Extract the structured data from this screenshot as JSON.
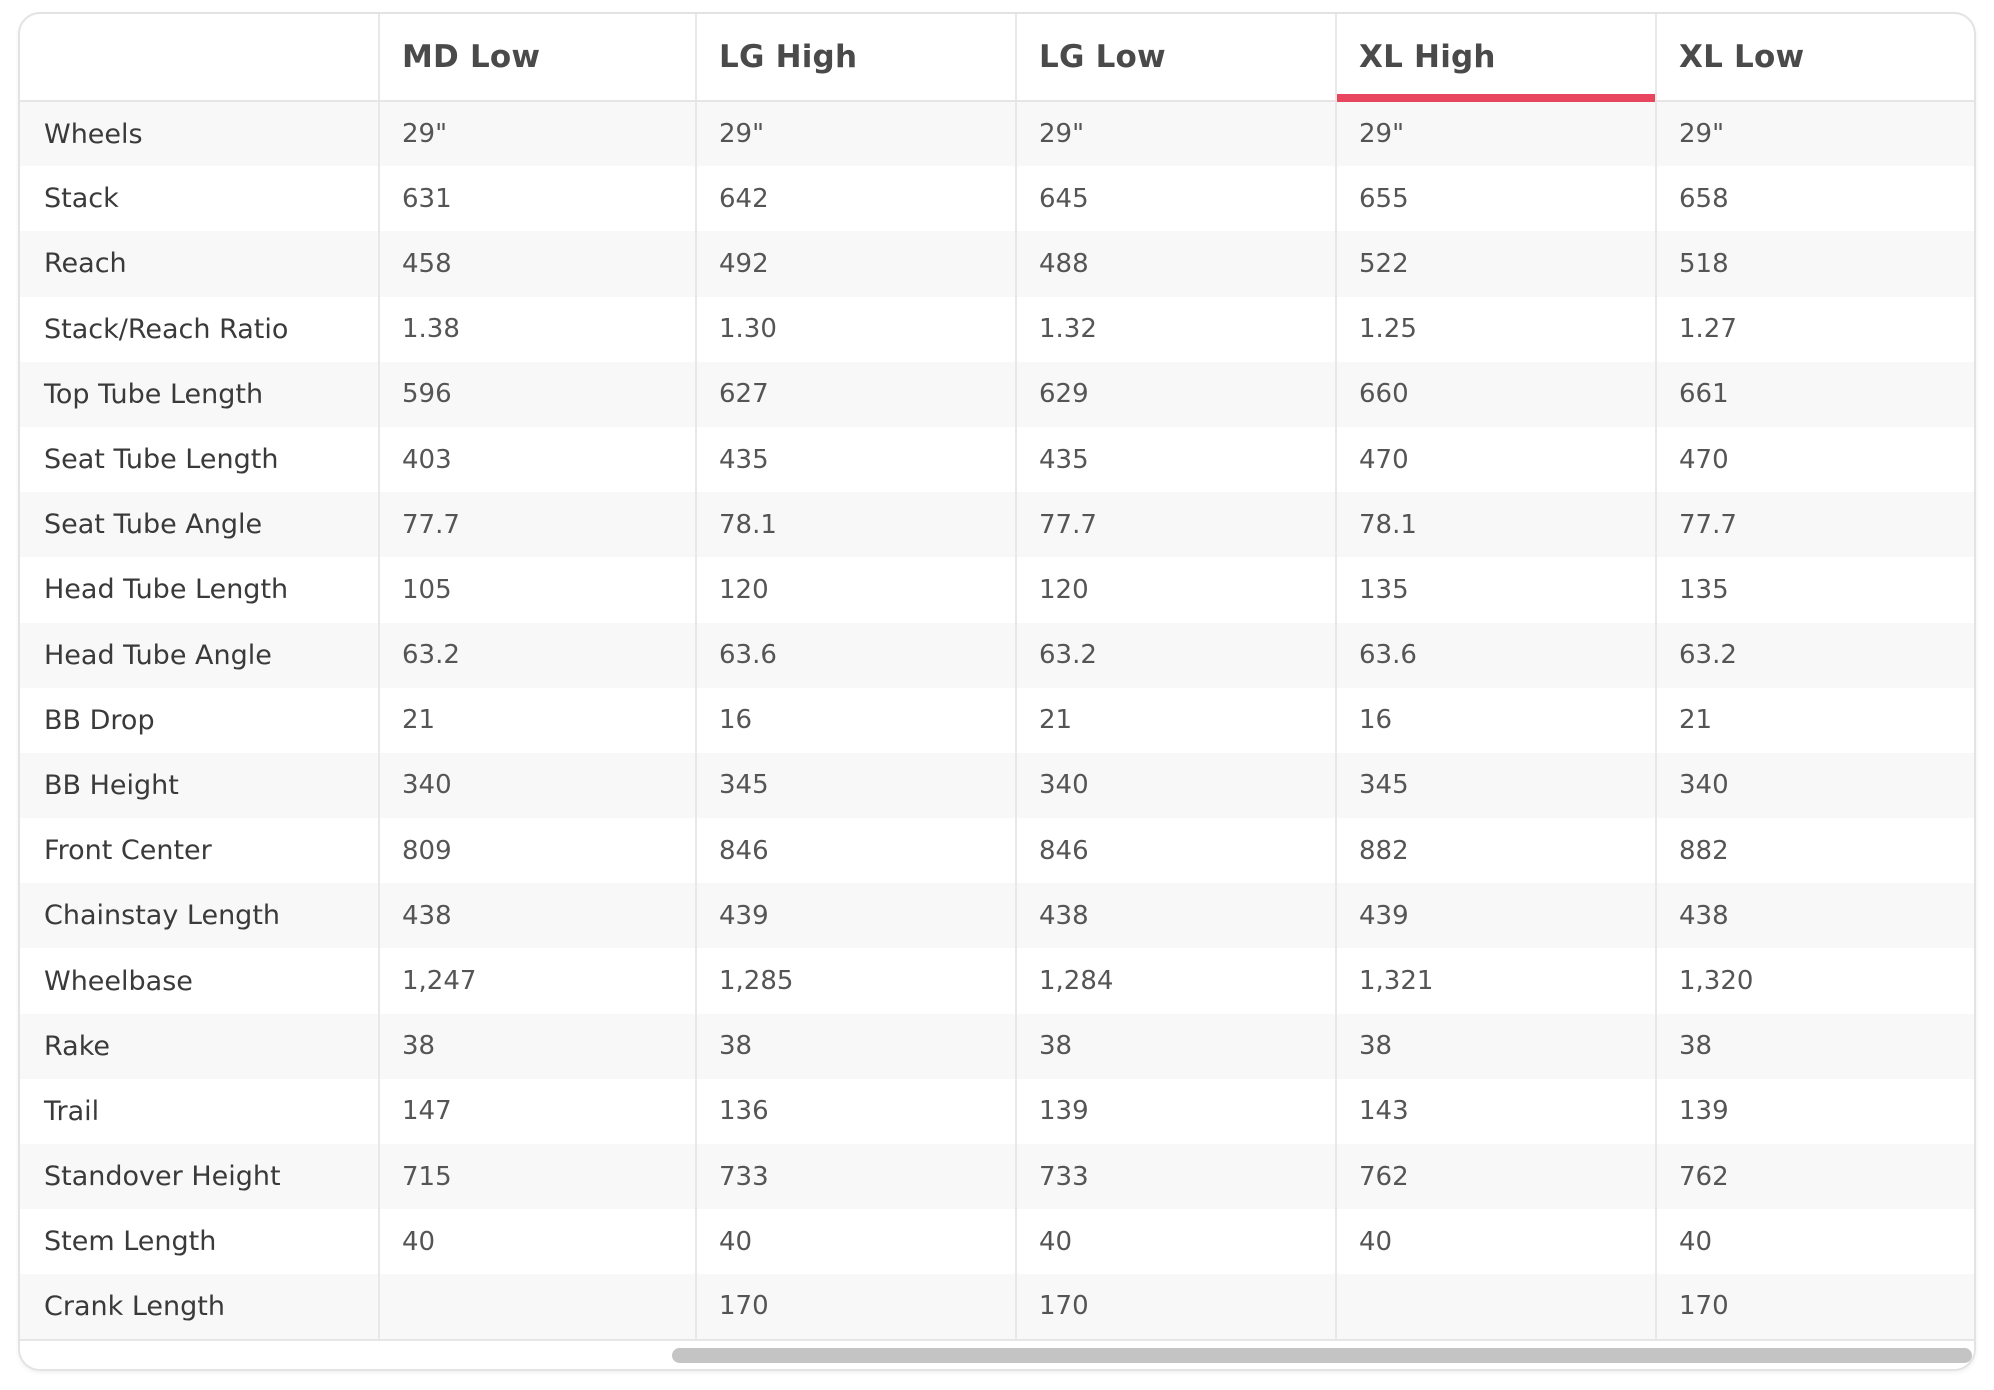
{
  "table": {
    "columns": [
      "",
      "MD Low",
      "LG High",
      "LG Low",
      "XL High",
      "XL Low"
    ],
    "active_column": "XL High",
    "active_color": "#e8465f",
    "rows": [
      {
        "label": "Wheels",
        "values": [
          "29\"",
          "29\"",
          "29\"",
          "29\"",
          "29\""
        ]
      },
      {
        "label": "Stack",
        "values": [
          "631",
          "642",
          "645",
          "655",
          "658"
        ]
      },
      {
        "label": "Reach",
        "values": [
          "458",
          "492",
          "488",
          "522",
          "518"
        ]
      },
      {
        "label": "Stack/Reach Ratio",
        "values": [
          "1.38",
          "1.30",
          "1.32",
          "1.25",
          "1.27"
        ]
      },
      {
        "label": "Top Tube Length",
        "values": [
          "596",
          "627",
          "629",
          "660",
          "661"
        ]
      },
      {
        "label": "Seat Tube Length",
        "values": [
          "403",
          "435",
          "435",
          "470",
          "470"
        ]
      },
      {
        "label": "Seat Tube Angle",
        "values": [
          "77.7",
          "78.1",
          "77.7",
          "78.1",
          "77.7"
        ]
      },
      {
        "label": "Head Tube Length",
        "values": [
          "105",
          "120",
          "120",
          "135",
          "135"
        ]
      },
      {
        "label": "Head Tube Angle",
        "values": [
          "63.2",
          "63.6",
          "63.2",
          "63.6",
          "63.2"
        ]
      },
      {
        "label": "BB Drop",
        "values": [
          "21",
          "16",
          "21",
          "16",
          "21"
        ]
      },
      {
        "label": "BB Height",
        "values": [
          "340",
          "345",
          "340",
          "345",
          "340"
        ]
      },
      {
        "label": "Front Center",
        "values": [
          "809",
          "846",
          "846",
          "882",
          "882"
        ]
      },
      {
        "label": "Chainstay Length",
        "values": [
          "438",
          "439",
          "438",
          "439",
          "438"
        ]
      },
      {
        "label": "Wheelbase",
        "values": [
          "1,247",
          "1,285",
          "1,284",
          "1,321",
          "1,320"
        ]
      },
      {
        "label": "Rake",
        "values": [
          "38",
          "38",
          "38",
          "38",
          "38"
        ]
      },
      {
        "label": "Trail",
        "values": [
          "147",
          "136",
          "139",
          "143",
          "139"
        ]
      },
      {
        "label": "Standover Height",
        "values": [
          "715",
          "733",
          "733",
          "762",
          "762"
        ]
      },
      {
        "label": "Stem Length",
        "values": [
          "40",
          "40",
          "40",
          "40",
          "40"
        ]
      },
      {
        "label": "Crank Length",
        "values": [
          "",
          "170",
          "170",
          "",
          "170"
        ]
      }
    ]
  }
}
